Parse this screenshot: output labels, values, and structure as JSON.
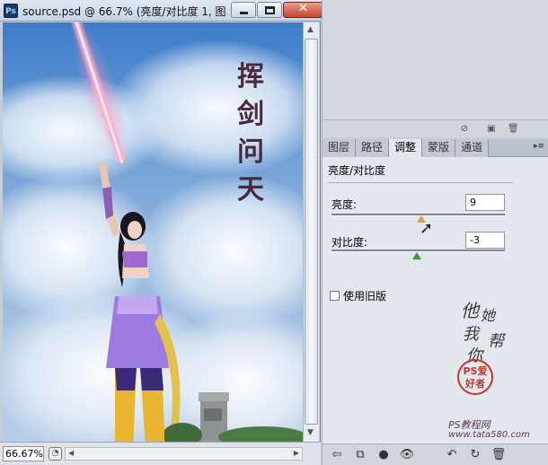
{
  "document": {
    "app_icon_label": "Ps",
    "title": "source.psd @ 66.7% (亮度/对比度 1, 图...",
    "zoom": "66.67%",
    "calligraphy": [
      "挥",
      "剑",
      "问",
      "天"
    ]
  },
  "top_panel": {},
  "tabs": [
    {
      "label": "图层",
      "active": false
    },
    {
      "label": "路径",
      "active": false
    },
    {
      "label": "调整",
      "active": true
    },
    {
      "label": "蒙版",
      "active": false
    },
    {
      "label": "通道",
      "active": false
    }
  ],
  "adjustment": {
    "title": "亮度/对比度",
    "brightness_label": "亮度:",
    "brightness_value": "9",
    "brightness_fraction": 0.52,
    "contrast_label": "对比度:",
    "contrast_value": "-3",
    "contrast_fraction": 0.49,
    "legacy_label": "使用旧版",
    "legacy_checked": false
  },
  "watermark": {
    "script": [
      "他",
      "她",
      "我",
      "帮",
      "你"
    ],
    "seal": "PS爱好者",
    "caption": "PS教程网",
    "url": "www.tata580.com"
  },
  "colors": {
    "brightness_thumb": "#d9a53e",
    "contrast_thumb": "#3c9a3c",
    "close_button": "#c2452d"
  }
}
